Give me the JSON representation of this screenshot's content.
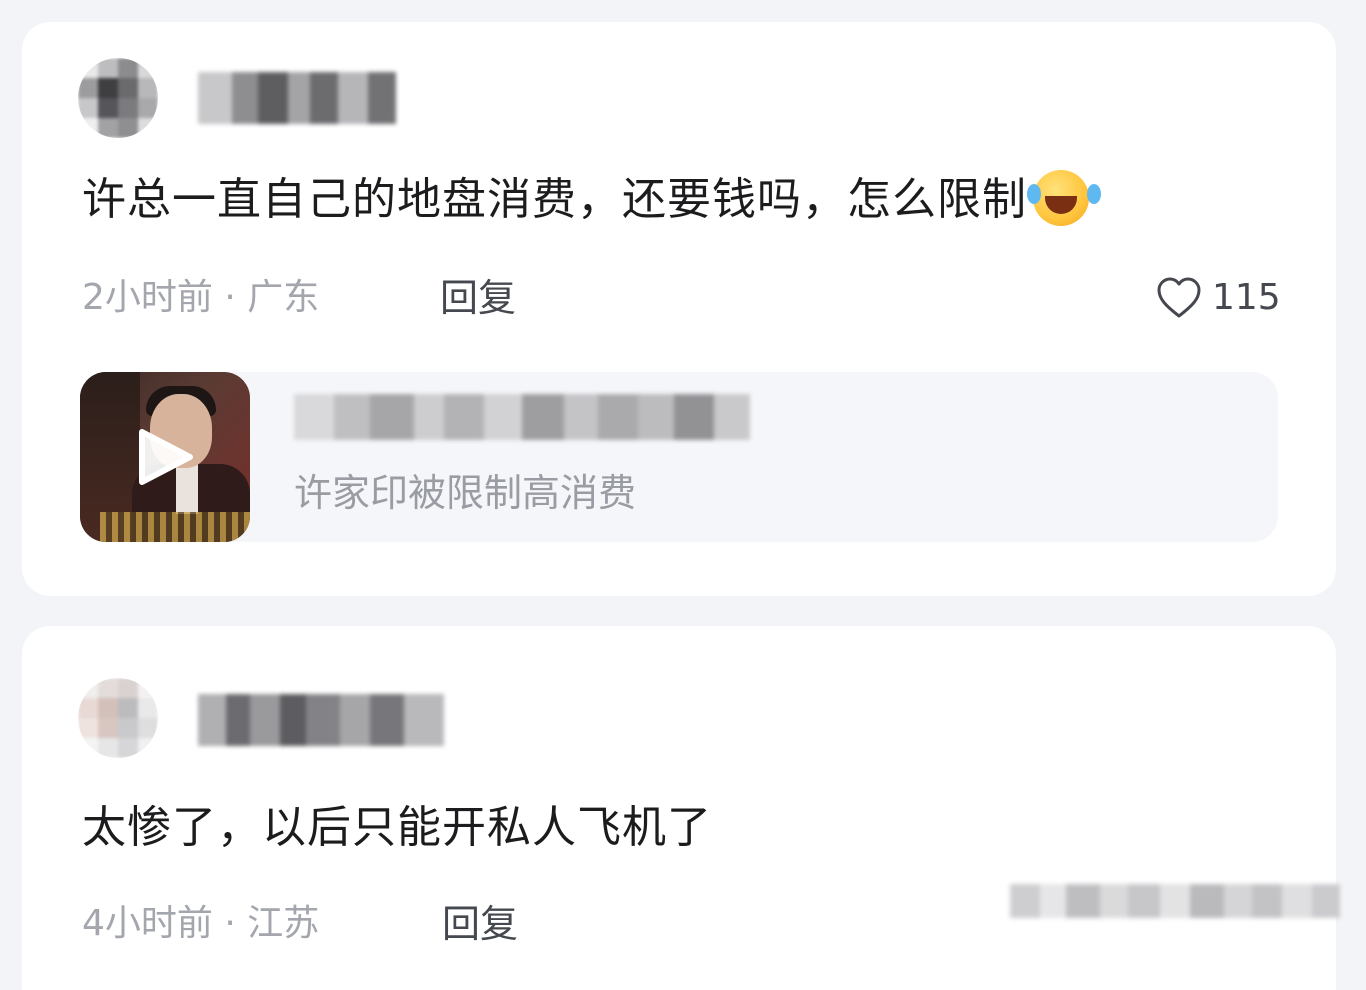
{
  "comments": [
    {
      "text": "许总一直自己的地盘消费，还要钱吗，怎么限制",
      "emoji": "laughing-tears-emoji",
      "time": "2小时前",
      "separator": "·",
      "location": "广东",
      "reply_label": "回复",
      "like_count": "115",
      "shared_post": {
        "subtitle": "许家印被限制高消费",
        "thumbnail_icon": "play-icon"
      }
    },
    {
      "text": "太惨了，以后只能开私人飞机了",
      "time": "4小时前",
      "separator": "·",
      "location": "江苏",
      "reply_label": "回复"
    }
  ],
  "colors": {
    "background": "#f3f4f7",
    "card": "#ffffff",
    "text_primary": "#1c1c1e",
    "text_meta": "#a3a6ad",
    "share_box": "#f5f6f9"
  }
}
